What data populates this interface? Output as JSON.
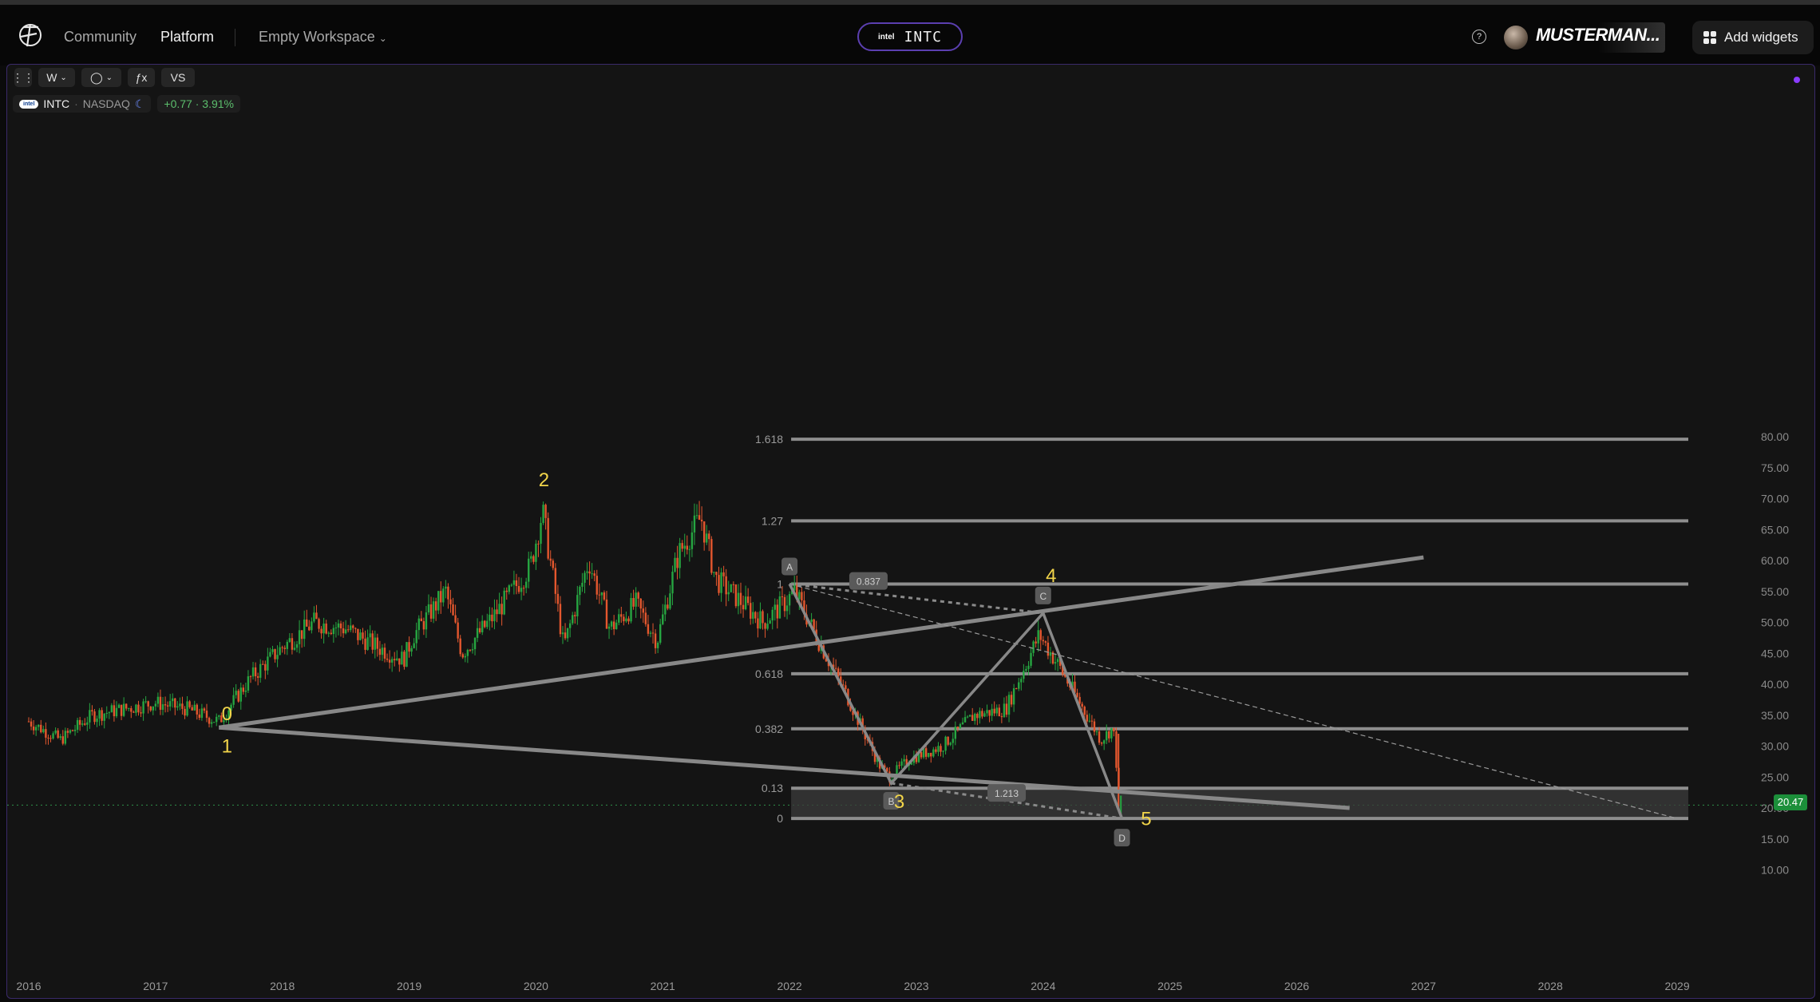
{
  "topbar": {
    "nav": {
      "community": "Community",
      "platform": "Platform",
      "workspace": "Empty Workspace"
    },
    "ticker": {
      "logo_text": "intel",
      "symbol": "INTC"
    },
    "user": {
      "name": "MUSTERMAN..."
    },
    "add_widgets_label": "Add widgets",
    "help_glyph": "?"
  },
  "toolbar": {
    "interval": "W",
    "indicators_glyph": "ƒx",
    "compare": "VS"
  },
  "legend": {
    "logo_text": "intel",
    "symbol": "INTC",
    "exchange": "NASDAQ",
    "change": "+0.77 · 3.91%"
  },
  "last_price": "20.47",
  "colors": {
    "up": "#26a641",
    "down": "#e4572e",
    "drawing": "#8a8a8a",
    "fib": "#8e8e8e",
    "accent": "#5b3fb0",
    "wave_label": "#f2d54a",
    "price_tag": "#1c8f3a"
  },
  "chart_data": {
    "type": "candlestick",
    "symbol": "INTC",
    "interval": "W",
    "x_ticks": [
      "2016",
      "2017",
      "2018",
      "2019",
      "2020",
      "2021",
      "2022",
      "2023",
      "2024",
      "2025",
      "2026",
      "2027",
      "2028",
      "2029"
    ],
    "y_ticks": [
      "10.00",
      "15.00",
      "20.00",
      "25.00",
      "30.00",
      "35.00",
      "40.00",
      "45.00",
      "50.00",
      "55.00",
      "60.00",
      "65.00",
      "70.00",
      "75.00",
      "80.00"
    ],
    "y_range": [
      8,
      80
    ],
    "price_path": [
      [
        "2016-01-01",
        34
      ],
      [
        "2016-04-01",
        31
      ],
      [
        "2016-07-01",
        35
      ],
      [
        "2016-10-01",
        36
      ],
      [
        "2017-01-01",
        37
      ],
      [
        "2017-04-01",
        36
      ],
      [
        "2017-07-01",
        34
      ],
      [
        "2017-10-01",
        41
      ],
      [
        "2018-01-01",
        46
      ],
      [
        "2018-04-01",
        50
      ],
      [
        "2018-07-01",
        49
      ],
      [
        "2018-10-01",
        46
      ],
      [
        "2018-12-15",
        44
      ],
      [
        "2019-01-15",
        48
      ],
      [
        "2019-04-15",
        55
      ],
      [
        "2019-06-01",
        45
      ],
      [
        "2019-09-01",
        51
      ],
      [
        "2019-12-15",
        59
      ],
      [
        "2020-01-20",
        68
      ],
      [
        "2020-03-20",
        46
      ],
      [
        "2020-06-01",
        60
      ],
      [
        "2020-08-01",
        49
      ],
      [
        "2020-10-15",
        53
      ],
      [
        "2020-12-15",
        47
      ],
      [
        "2021-02-15",
        61
      ],
      [
        "2021-04-20",
        67
      ],
      [
        "2021-06-01",
        57
      ],
      [
        "2021-08-01",
        54
      ],
      [
        "2021-10-15",
        50
      ],
      [
        "2021-12-15",
        53
      ],
      [
        "2022-01-15",
        55
      ],
      [
        "2022-03-15",
        48
      ],
      [
        "2022-06-15",
        38
      ],
      [
        "2022-09-15",
        27
      ],
      [
        "2022-10-15",
        25
      ],
      [
        "2022-12-15",
        28
      ],
      [
        "2023-03-15",
        30
      ],
      [
        "2023-06-15",
        35
      ],
      [
        "2023-09-15",
        36
      ],
      [
        "2023-12-20",
        48
      ],
      [
        "2024-02-15",
        43
      ],
      [
        "2024-04-15",
        37
      ],
      [
        "2024-06-15",
        31
      ],
      [
        "2024-07-20",
        33
      ],
      [
        "2024-08-10",
        20
      ]
    ],
    "wave_labels": [
      {
        "text": "0",
        "date": "2017-07-01",
        "price": 34.2
      },
      {
        "text": "1",
        "date": "2017-07-01",
        "price": 29.0
      },
      {
        "text": "2",
        "date": "2020-01-01",
        "price": 72.0
      },
      {
        "text": "3",
        "date": "2022-10-20",
        "price": 20.0
      },
      {
        "text": "4",
        "date": "2024-01-01",
        "price": 56.5
      },
      {
        "text": "5",
        "date": "2024-10-01",
        "price": 17.2
      }
    ],
    "fib_retracement": {
      "start": "2022-01-01",
      "end": "2029-01-01",
      "levels": [
        {
          "label": "1.618",
          "price": 79.6
        },
        {
          "label": "1.27",
          "price": 66.4
        },
        {
          "label": "1",
          "price": 56.2
        },
        {
          "label": "0.618",
          "price": 41.7
        },
        {
          "label": "0.382",
          "price": 32.8
        },
        {
          "label": "0.13",
          "price": 23.2
        },
        {
          "label": "0",
          "price": 18.3
        }
      ]
    },
    "abcd_pattern": {
      "points": [
        {
          "label": "A",
          "date": "2022-01-01",
          "price": 56.2
        },
        {
          "label": "B",
          "date": "2022-10-20",
          "price": 24.0
        },
        {
          "label": "C",
          "date": "2024-01-01",
          "price": 51.5
        },
        {
          "label": "D",
          "date": "2024-08-15",
          "price": 18.3
        }
      ],
      "ratios": [
        "0.837",
        "1.213"
      ]
    },
    "trendlines": [
      {
        "from": [
          "2017-07-01",
          33.0
        ],
        "to": [
          "2027-01-01",
          60.5
        ],
        "style": "solid"
      },
      {
        "from": [
          "2017-07-01",
          33.0
        ],
        "to": [
          "2026-06-01",
          20.0
        ],
        "style": "solid"
      },
      {
        "from": [
          "2022-01-01",
          56.2
        ],
        "to": [
          "2029-01-01",
          18.3
        ],
        "style": "dashed"
      }
    ]
  }
}
